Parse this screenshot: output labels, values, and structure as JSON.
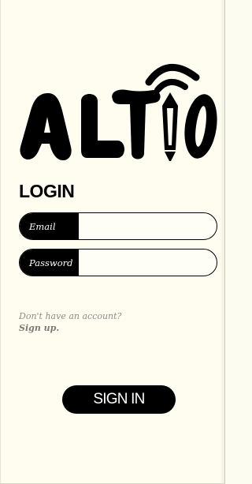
{
  "brand": {
    "name": "ALTIO",
    "logo_icon": "wifi-pencil-logo"
  },
  "login": {
    "heading": "LOGIN",
    "email_label": "Email",
    "email_value": "",
    "password_label": "Password",
    "password_value": ""
  },
  "signup": {
    "question": "Don't have an account?",
    "link": "Sign up."
  },
  "actions": {
    "signin_label": "SIGN IN"
  },
  "colors": {
    "background": "#fefdf0",
    "primary": "#000000",
    "muted_text": "#8d8c86"
  }
}
